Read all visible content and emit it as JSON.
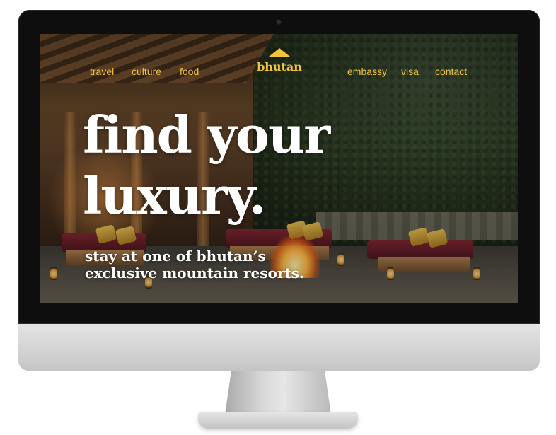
{
  "nav": {
    "left_links": [
      "travel",
      "culture",
      "food"
    ],
    "right_links": [
      "embassy",
      "visa",
      "contact"
    ],
    "brand": "bhutan"
  },
  "hero": {
    "title_line1": "find your",
    "title_line2": "luxury.",
    "subtitle_line1": "stay at one of bhutan’s",
    "subtitle_line2": "exclusive mountain resorts."
  },
  "colors": {
    "accent": "#f2c53d",
    "hero_text": "#ffffff",
    "monitor_bezel": "#0e0e0f",
    "monitor_chin": "#d4d4d4"
  },
  "icons": {
    "brand_mark": "triangle-mountain-icon"
  }
}
